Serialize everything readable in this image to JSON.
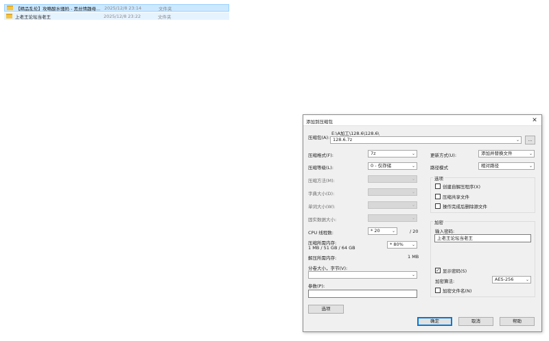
{
  "explorer": {
    "rows": [
      {
        "name": "【精品乱伦】攻略酸水骚妈 - 黑丝情趣母...",
        "date": "2025/12/8 23:14",
        "type": "文件夹"
      },
      {
        "name": "上老王论坛当老王",
        "date": "2025/12/8 23:22",
        "type": "文件夹"
      }
    ]
  },
  "dialog": {
    "title": "添加到压缩包",
    "close_glyph": "✕",
    "archive_label": "压缩包(A):",
    "archive_path": "E:\\A加工\\128.6\\128.6\\",
    "archive_name": "128.6.7z",
    "browse_label": "...",
    "format_label": "压缩格式(F):",
    "format_value": "7z",
    "level_label": "压缩等级(L):",
    "level_value": "0 - 仅存储",
    "method_label": "压缩方法(M):",
    "dict_label": "字典大小(D):",
    "word_label": "单词大小(W):",
    "solid_label": "固实数据大小:",
    "cpu_label": "CPU 线程数:",
    "cpu_value": "* 20",
    "cpu_max": "/ 20",
    "mem_comp_label": "压缩所需内存:",
    "mem_comp_info": "1 MB / 51 GB / 64 GB",
    "mem_percent": "* 80%",
    "mem_decomp_label": "解压所需内存:",
    "mem_decomp_value": "1 MB",
    "split_label": "分卷大小，字节(V):",
    "params_label": "参数(P):",
    "options_btn": "选项",
    "update_label": "更新方式(U):",
    "update_value": "添加并替换文件",
    "path_label": "路径模式",
    "path_value": "相对路径",
    "options_group": "选项",
    "opt_sfx": "创建自解压程序(X)",
    "opt_shared": "压缩共享文件",
    "opt_delete": "操作完成后删除源文件",
    "encrypt_group": "加密",
    "pwd_label": "输入密码:",
    "pwd_value": "上老王论坛当老王",
    "show_pwd": "显示密码(S)",
    "enc_method_label": "加密算法:",
    "enc_method_value": "AES-256",
    "enc_names": "加密文件名(N)",
    "ok": "确定",
    "cancel": "取消",
    "help": "帮助",
    "check_glyph": "✓",
    "arrow_glyph": "⌄"
  }
}
